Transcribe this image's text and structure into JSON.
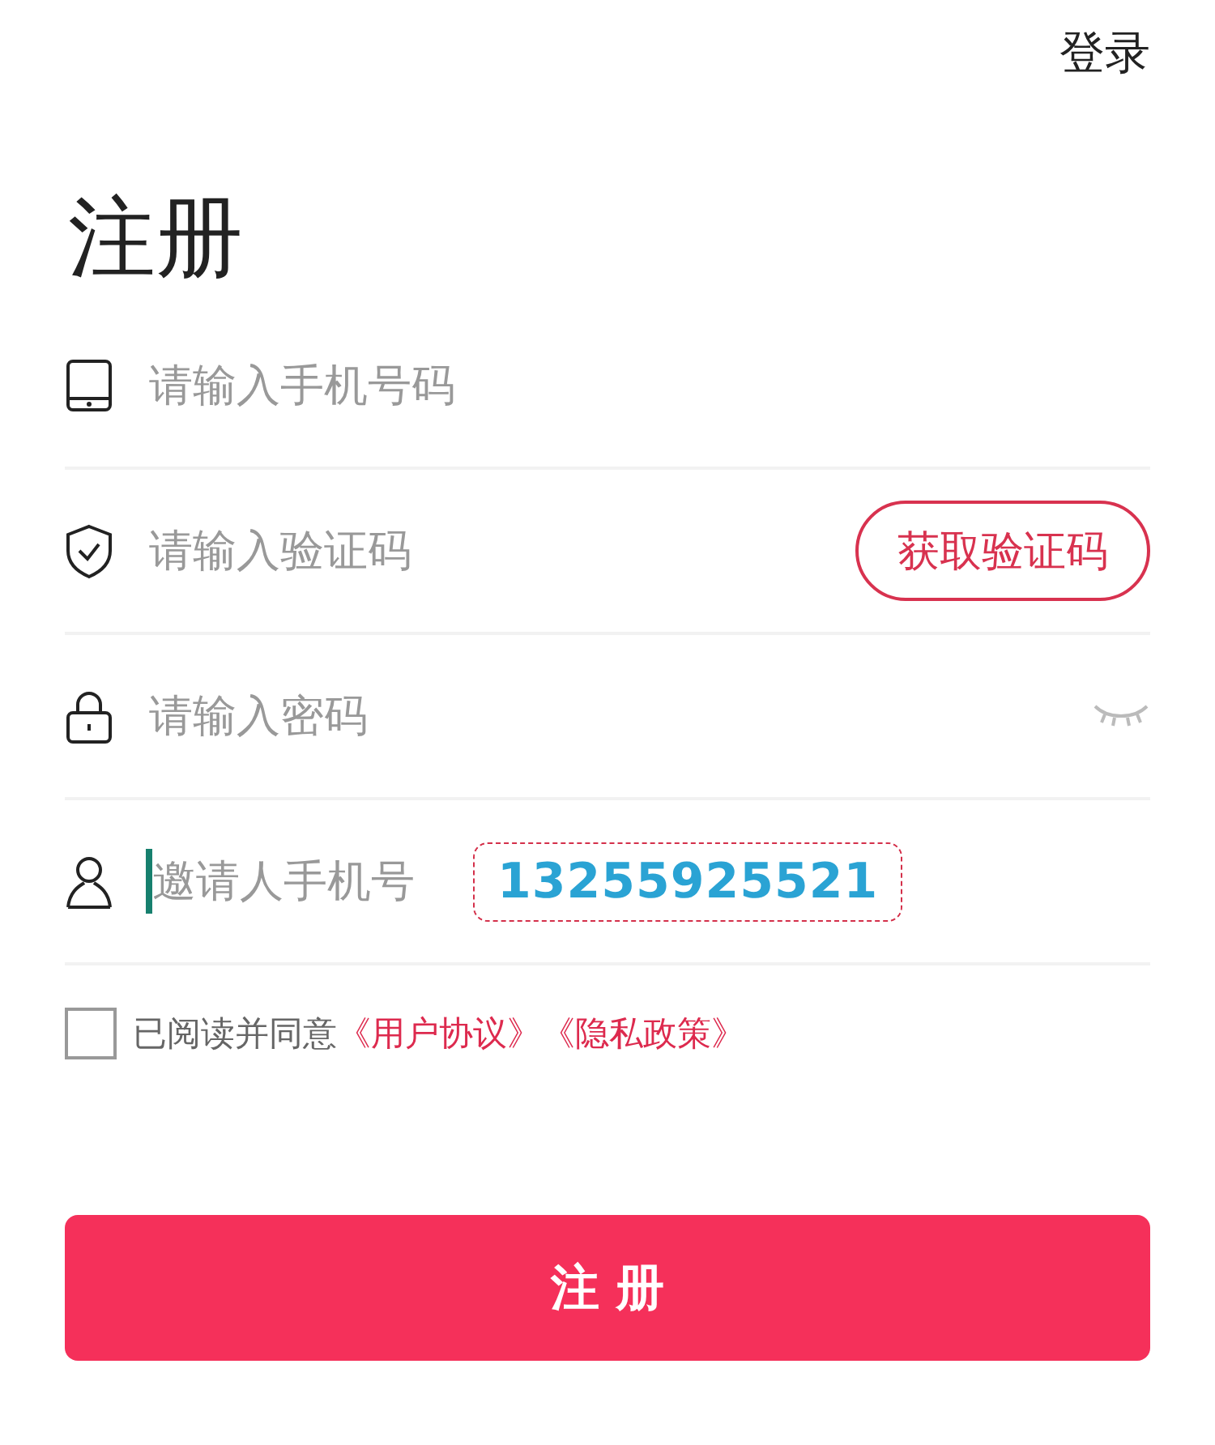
{
  "header": {
    "login_link": "登录"
  },
  "title": "注册",
  "fields": [
    {
      "kind": "phone",
      "placeholder": "请输入手机号码"
    },
    {
      "kind": "code",
      "placeholder": "请输入验证码",
      "action": "获取验证码"
    },
    {
      "kind": "password",
      "placeholder": "请输入密码",
      "visible": false
    },
    {
      "kind": "invite",
      "placeholder": "邀请人手机号",
      "focused": true,
      "note": "13255925521"
    }
  ],
  "agreement": {
    "checked": false,
    "text": "已阅读并同意",
    "links": [
      "《用户协议》",
      "《隐私政策》"
    ]
  },
  "submit": "注 册"
}
